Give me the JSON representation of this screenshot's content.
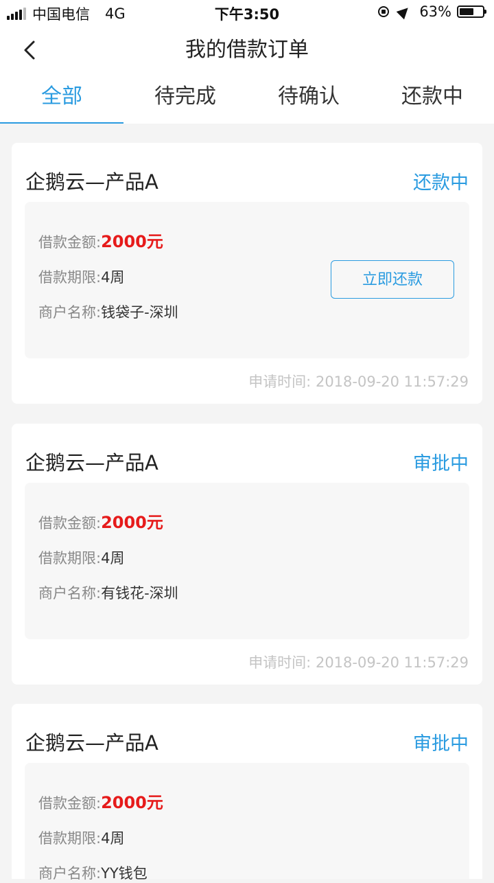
{
  "status_bar": {
    "carrier": "中国电信",
    "network": "4G",
    "time": "下午3:50",
    "battery": "63%",
    "battery_level": 0.63
  },
  "nav": {
    "title": "我的借款订单",
    "back_icon": "chevron-left-icon"
  },
  "tabs": [
    {
      "label": "全部",
      "active": true
    },
    {
      "label": "待完成",
      "active": false
    },
    {
      "label": "待确认",
      "active": false
    },
    {
      "label": "还款中",
      "active": false
    }
  ],
  "labels": {
    "amount": "借款金额:",
    "term": "借款期限:",
    "merchant": "商户名称:",
    "apply_time": "申请时间:"
  },
  "orders": [
    {
      "product": "企鹅云—产品A",
      "status": "还款中",
      "amount": "2000元",
      "term": "4周",
      "merchant": "钱袋子-深圳",
      "apply_time": "2018-09-20 11:57:29",
      "action": "立即还款"
    },
    {
      "product": "企鹅云—产品A",
      "status": "审批中",
      "amount": "2000元",
      "term": "4周",
      "merchant": "有钱花-深圳",
      "apply_time": "2018-09-20 11:57:29"
    },
    {
      "product": "企鹅云—产品A",
      "status": "审批中",
      "amount": "2000元",
      "term": "4周",
      "merchant": "YY钱包",
      "apply_time": ""
    }
  ],
  "colors": {
    "accent": "#2a9be0",
    "amount": "#e61b1b",
    "background": "#f4f4f4"
  }
}
